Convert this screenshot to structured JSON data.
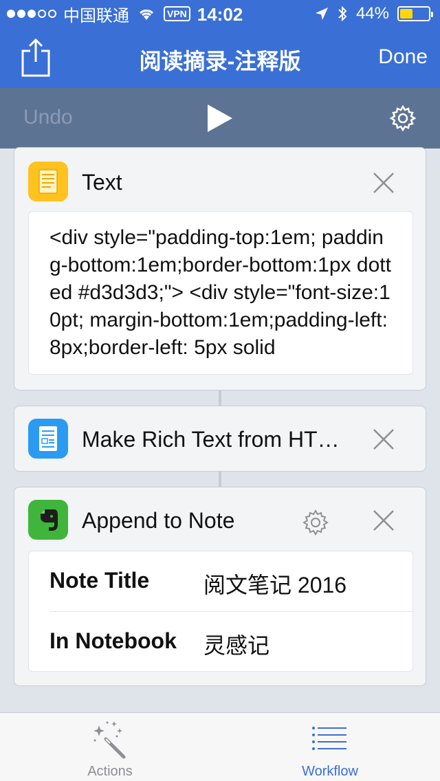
{
  "status_bar": {
    "carrier": "中国联通",
    "vpn": "VPN",
    "time": "14:02",
    "battery": "44%",
    "battery_level": 0.44,
    "signal_bars_filled": 3,
    "signal_bars_total": 5
  },
  "nav": {
    "title": "阅读摘录-注释版",
    "done": "Done",
    "share_icon": "share-icon"
  },
  "toolbar": {
    "undo": "Undo",
    "play_icon": "play-icon",
    "settings_icon": "gear-icon"
  },
  "actions": [
    {
      "title": "Text",
      "icon": "text-note-icon",
      "icon_color": "#ffc21e",
      "content": "<div style=\"padding-top:1em; padding-bottom:1em;border-bottom:1px dotted #d3d3d3;\"> <div style=\"font-size:10pt; margin-bottom:1em;padding-left: 8px;border-left: 5px solid"
    },
    {
      "title": "Make Rich Text from HT…",
      "icon": "rich-text-icon",
      "icon_color": "#2a9bf0"
    },
    {
      "title": "Append to Note",
      "icon": "evernote-icon",
      "icon_color": "#3fb53b",
      "params": [
        {
          "label": "Note Title",
          "value": "阅文笔记 2016"
        },
        {
          "label": "In Notebook",
          "value": "灵感记"
        }
      ]
    }
  ],
  "tabs": [
    {
      "label": "Actions",
      "icon": "magic-wand-icon",
      "color": "#8e8e93"
    },
    {
      "label": "Workflow",
      "icon": "list-icon",
      "color": "#3a6fd6"
    }
  ],
  "colors": {
    "accent": "#3a6fd6",
    "toolbar": "#5d7394",
    "background": "#dfe3ea"
  }
}
